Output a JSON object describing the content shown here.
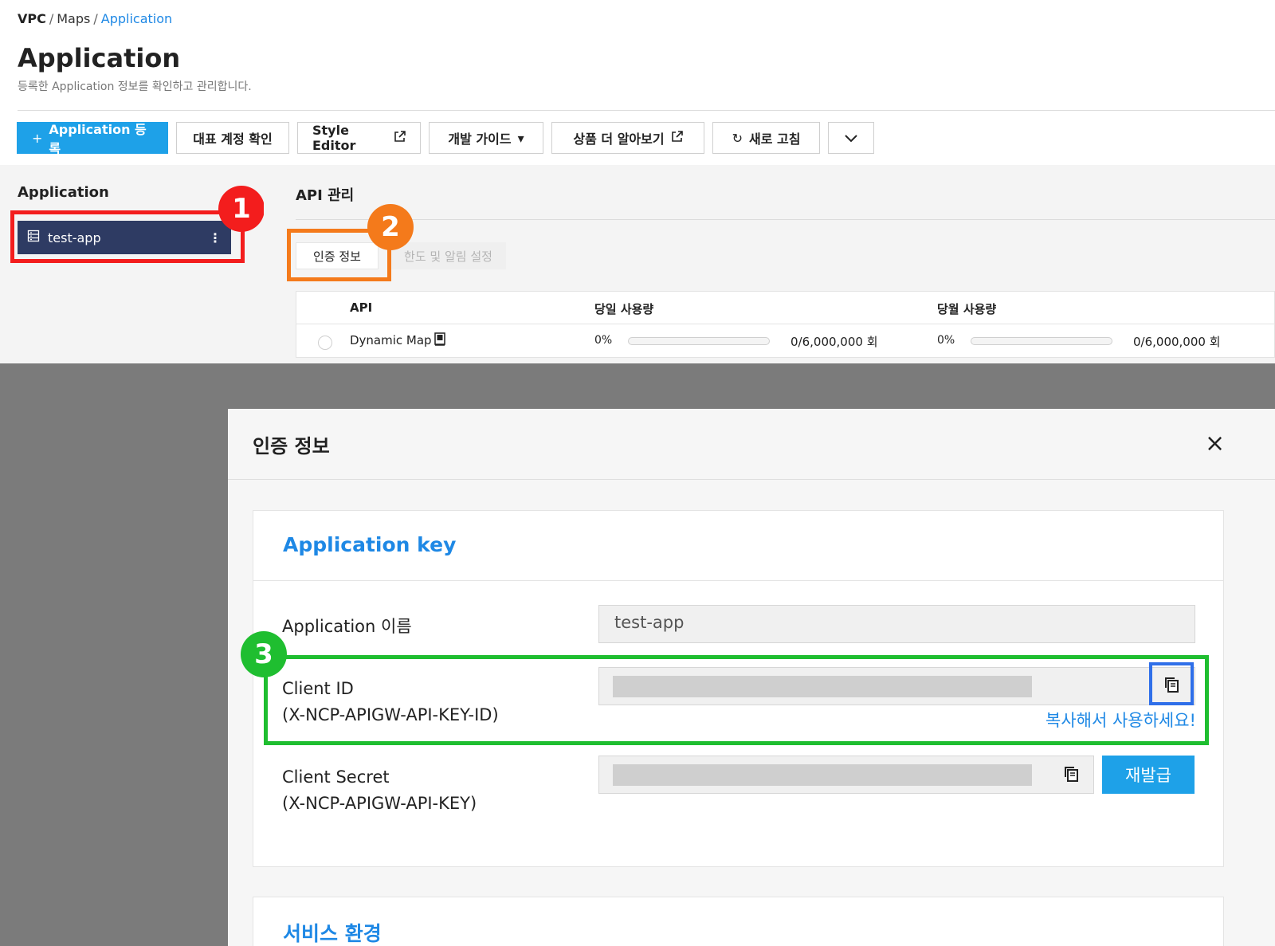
{
  "breadcrumb": {
    "item1": "VPC",
    "sep1": "/",
    "item2": "Maps",
    "sep2": "/",
    "item3": "Application"
  },
  "page": {
    "title": "Application",
    "subtitle": "등록한 Application 정보를 확인하고 관리합니다."
  },
  "toolbar": {
    "register_label": "Application 등록",
    "account_label": "대표 계정 확인",
    "style_editor_label": "Style Editor",
    "dev_guide_label": "개발 가이드",
    "learn_more_label": "상품 더 알아보기",
    "refresh_label": "새로 고침"
  },
  "sidebar": {
    "title": "Application",
    "items": [
      {
        "label": "test-app"
      }
    ]
  },
  "api_panel": {
    "title": "API 관리",
    "tabs": [
      {
        "label": "인증 정보",
        "active": true
      },
      {
        "label": "한도 및 알림 설정",
        "active": false
      }
    ],
    "table": {
      "headers": {
        "api": "API",
        "daily": "당일 사용량",
        "monthly": "당월 사용량"
      },
      "rows": [
        {
          "api": "Dynamic Map",
          "daily_pct": "0%",
          "daily_progress": 0,
          "daily_count": "0/6,000,000 회",
          "monthly_pct": "0%",
          "monthly_progress": 0,
          "monthly_count": "0/6,000,000 회"
        }
      ]
    }
  },
  "modal": {
    "title": "인증 정보",
    "close_icon": "×",
    "section_title": "Application key",
    "app_name_label": "Application 이름",
    "app_name_value": "test-app",
    "client_id_label": "Client ID",
    "client_id_header": "(X-NCP-APIGW-API-KEY-ID)",
    "client_secret_label": "Client Secret",
    "client_secret_header": "(X-NCP-APIGW-API-KEY)",
    "copy_hint": "복사해서 사용하세요!",
    "reissue_label": "재발급",
    "next_section_title": "서비스 환경"
  },
  "annotations": {
    "step1": "1",
    "step2": "2",
    "step3": "3"
  },
  "colors": {
    "primary": "#1ea1e8",
    "link": "#1e88e5",
    "sidebar_active": "#2e3b63",
    "highlight_red": "#f31d1d",
    "highlight_orange": "#f47a1b",
    "highlight_green": "#1fbe30",
    "highlight_blue": "#2f6fe9"
  }
}
